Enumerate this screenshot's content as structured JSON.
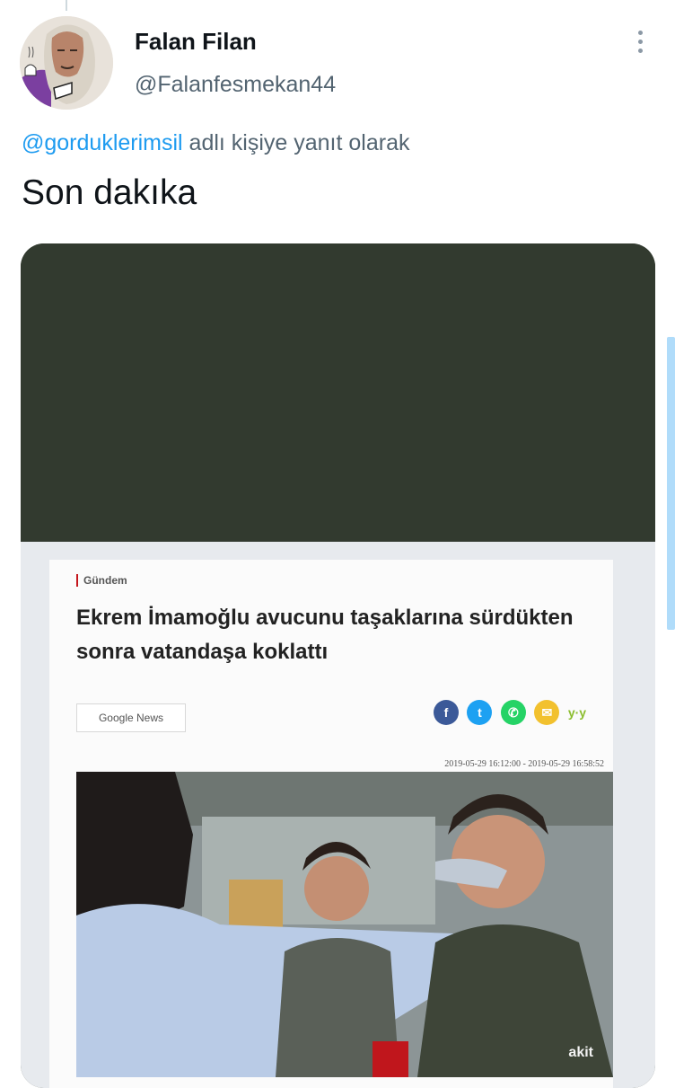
{
  "tweet": {
    "author": {
      "display_name": "Falan Filan",
      "handle": "@Falanfesmekan44"
    },
    "reply_to": {
      "mention": "@gorduklerimsil",
      "suffix": " adlı kişiye yanıt olarak"
    },
    "text": "Son dakıka",
    "more_icon": "more-vertical-icon"
  },
  "embedded_article": {
    "category": "Gündem",
    "headline": "Ekrem İmamoğlu avucunu taşaklarına sürdükten sonra vatandaşa koklattı",
    "google_news_label": "Google News",
    "share_icons": [
      "facebook-icon",
      "twitter-icon",
      "whatsapp-icon",
      "email-icon"
    ],
    "share_extra": "y·y",
    "dates": "2019-05-29 16:12:00 - 2019-05-29 16:58:52",
    "watermark": "akit"
  },
  "colors": {
    "accent": "#1d9bf0",
    "text": "#0f1419",
    "secondary": "#536471",
    "media_bg": "#323a2f"
  }
}
